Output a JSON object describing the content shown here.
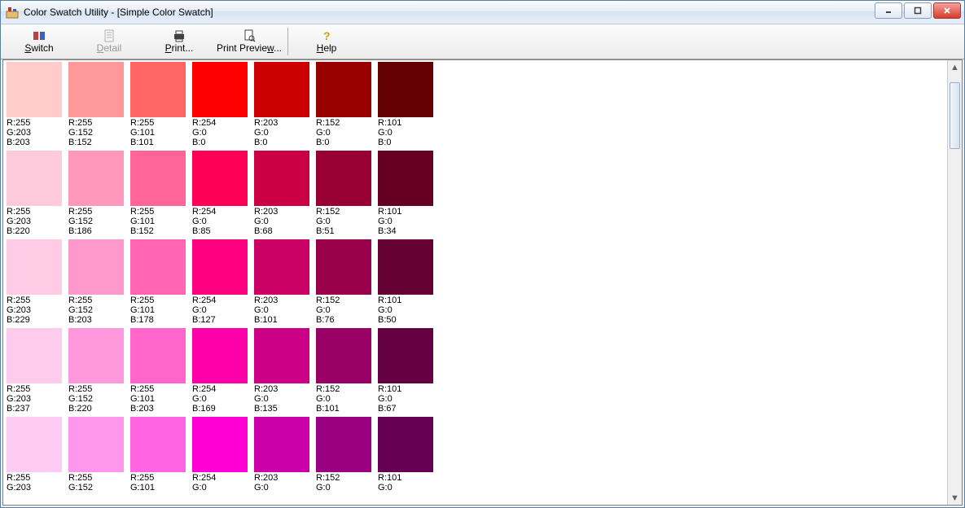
{
  "window": {
    "title": "Color Swatch Utility - [Simple Color Swatch]"
  },
  "toolbar": {
    "switch": "Switch",
    "detail": "Detail",
    "print": "Print...",
    "preview": "Print Preview...",
    "help": "Help"
  },
  "rows": [
    [
      {
        "r": 255,
        "g": 203,
        "b": 203
      },
      {
        "r": 255,
        "g": 152,
        "b": 152
      },
      {
        "r": 255,
        "g": 101,
        "b": 101
      },
      {
        "r": 254,
        "g": 0,
        "b": 0
      },
      {
        "r": 203,
        "g": 0,
        "b": 0
      },
      {
        "r": 152,
        "g": 0,
        "b": 0
      },
      {
        "r": 101,
        "g": 0,
        "b": 0
      }
    ],
    [
      {
        "r": 255,
        "g": 203,
        "b": 220
      },
      {
        "r": 255,
        "g": 152,
        "b": 186
      },
      {
        "r": 255,
        "g": 101,
        "b": 152
      },
      {
        "r": 254,
        "g": 0,
        "b": 85
      },
      {
        "r": 203,
        "g": 0,
        "b": 68
      },
      {
        "r": 152,
        "g": 0,
        "b": 51
      },
      {
        "r": 101,
        "g": 0,
        "b": 34
      }
    ],
    [
      {
        "r": 255,
        "g": 203,
        "b": 229
      },
      {
        "r": 255,
        "g": 152,
        "b": 203
      },
      {
        "r": 255,
        "g": 101,
        "b": 178
      },
      {
        "r": 254,
        "g": 0,
        "b": 127
      },
      {
        "r": 203,
        "g": 0,
        "b": 101
      },
      {
        "r": 152,
        "g": 0,
        "b": 76
      },
      {
        "r": 101,
        "g": 0,
        "b": 50
      }
    ],
    [
      {
        "r": 255,
        "g": 203,
        "b": 237
      },
      {
        "r": 255,
        "g": 152,
        "b": 220
      },
      {
        "r": 255,
        "g": 101,
        "b": 203
      },
      {
        "r": 254,
        "g": 0,
        "b": 169
      },
      {
        "r": 203,
        "g": 0,
        "b": 135
      },
      {
        "r": 152,
        "g": 0,
        "b": 101
      },
      {
        "r": 101,
        "g": 0,
        "b": 67
      }
    ],
    [
      {
        "r": 255,
        "g": 203,
        "b": null
      },
      {
        "r": 255,
        "g": 152,
        "b": null
      },
      {
        "r": 255,
        "g": 101,
        "b": null
      },
      {
        "r": 254,
        "g": 0,
        "b": null
      },
      {
        "r": 203,
        "g": 0,
        "b": null
      },
      {
        "r": 152,
        "g": 0,
        "b": null
      },
      {
        "r": 101,
        "g": 0,
        "b": null
      }
    ]
  ],
  "row5_swatch_colors": [
    "#ffcbf5",
    "#ff98ec",
    "#ff65e2",
    "#fe00d4",
    "#cb00a9",
    "#98007f",
    "#650054"
  ]
}
